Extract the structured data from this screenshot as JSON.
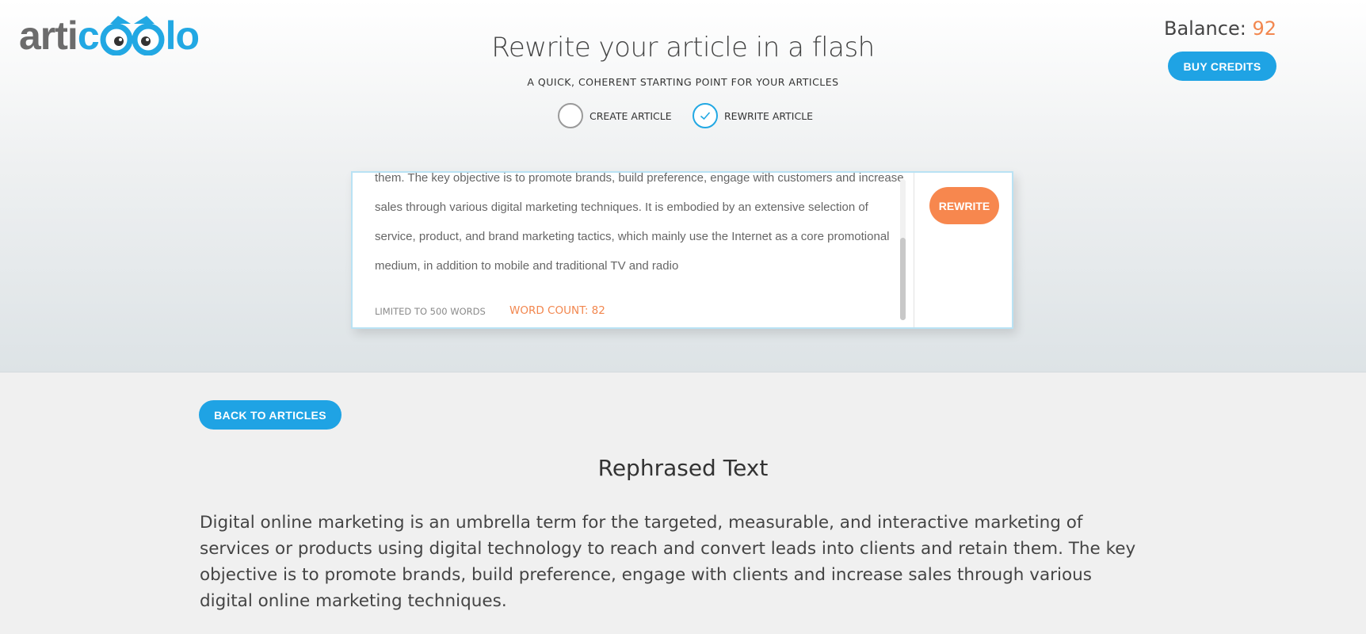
{
  "logo": {
    "text_left": "arti",
    "text_mid_c": "c",
    "text_right": "lo"
  },
  "header": {
    "title": "Rewrite your article in a flash",
    "subtitle": "A QUICK, COHERENT STARTING POINT FOR YOUR ARTICLES"
  },
  "modes": [
    {
      "label": "CREATE ARTICLE",
      "selected": false
    },
    {
      "label": "REWRITE ARTICLE",
      "selected": true
    }
  ],
  "account": {
    "balance_label": "Balance:",
    "balance_value": "92",
    "buy_label": "BUY CREDITS"
  },
  "editor": {
    "text": "them. The key objective is to promote brands, build preference, engage with customers and increase sales through various digital marketing techniques. It is embodied by an extensive selection of service, product, and brand marketing tactics, which mainly use the Internet as a core promotional medium, in addition to mobile and traditional TV and radio",
    "limit_label": "LIMITED TO 500 WORDS",
    "word_count_label": "WORD COUNT: 82",
    "rewrite_label": "REWRITE"
  },
  "result": {
    "back_label": "BACK TO ARTICLES",
    "title": "Rephrased Text",
    "text": "Digital online marketing is an umbrella term for the targeted, measurable, and interactive marketing of services or products using digital technology to reach and convert leads into clients and retain them. The key objective is to promote brands, build preference, engage with clients and increase sales through various digital online marketing techniques."
  },
  "colors": {
    "brand_blue": "#1fa3e4",
    "accent_orange": "#f7874e",
    "logo_grey": "#6c6c6c"
  },
  "icons": {
    "mode_check": "check-icon",
    "logo_mark": "owl-icon"
  }
}
